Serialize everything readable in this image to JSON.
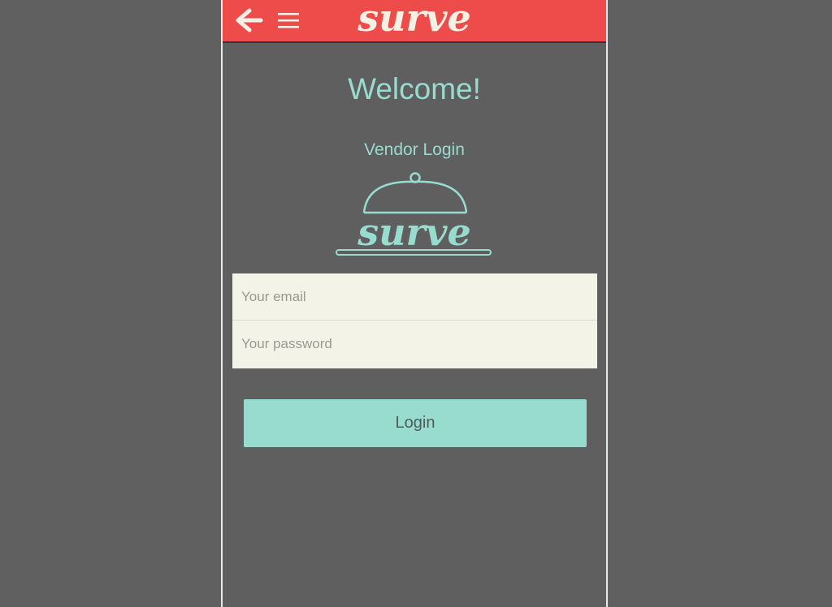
{
  "header": {
    "brand": "surve",
    "back_icon": "back-arrow-icon",
    "menu_icon": "hamburger-menu-icon",
    "bar_color": "#ee4b4b"
  },
  "welcome": "Welcome!",
  "subtitle": "Vendor Login",
  "logo": {
    "text": "surve",
    "icon": "serving-cloche-icon"
  },
  "form": {
    "email_placeholder": "Your email",
    "email_value": "",
    "password_placeholder": "Your password",
    "password_value": ""
  },
  "login_label": "Login",
  "colors": {
    "accent": "#98dccf",
    "header": "#ee4b4b",
    "background": "#606060",
    "input_bg": "#f3f3e8"
  }
}
